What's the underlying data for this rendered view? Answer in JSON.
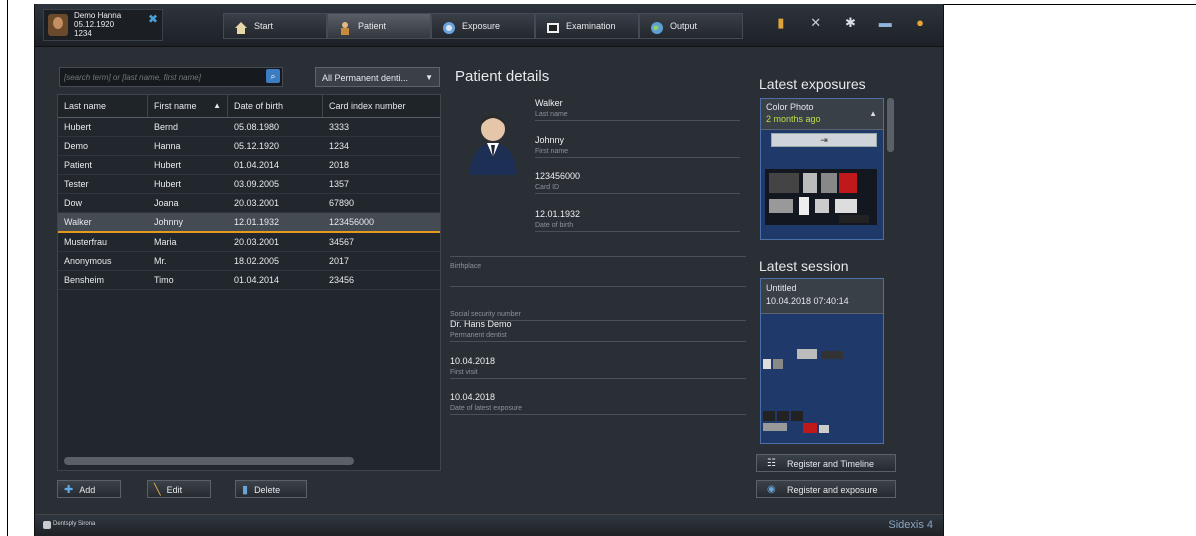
{
  "header": {
    "patient": {
      "name": "Demo Hanna",
      "dob": "05.12.1920",
      "id": "1234"
    },
    "tabs": [
      {
        "label": "Start",
        "icon": "home-icon"
      },
      {
        "label": "Patient",
        "icon": "person-icon"
      },
      {
        "label": "Exposure",
        "icon": "camera-icon"
      },
      {
        "label": "Examination",
        "icon": "monitor-icon"
      },
      {
        "label": "Output",
        "icon": "globe-icon"
      }
    ],
    "active_tab": "Patient",
    "tool_icons": [
      "bookmark-icon",
      "tools-icon",
      "gear-icon",
      "window-icon",
      "info-icon"
    ]
  },
  "patients": {
    "search_placeholder": "[search term] or [last name, first name]",
    "filter": "All Permanent denti...",
    "columns": [
      "Last name",
      "First name",
      "Date of birth",
      "Card index number"
    ],
    "rows": [
      [
        "Hubert",
        "Bernd",
        "05.08.1980",
        "3333"
      ],
      [
        "Demo",
        "Hanna",
        "05.12.1920",
        "1234"
      ],
      [
        "Patient",
        "Hubert",
        "01.04.2014",
        "2018"
      ],
      [
        "Tester",
        "Hubert",
        "03.09.2005",
        "1357"
      ],
      [
        "Dow",
        "Joana",
        "20.03.2001",
        "67890"
      ],
      [
        "Walker",
        "Johnny",
        "12.01.1932",
        "123456000"
      ],
      [
        "Musterfrau",
        "Maria",
        "20.03.2001",
        "34567"
      ],
      [
        "Anonymous",
        "Mr.",
        "18.02.2005",
        "2017"
      ],
      [
        "Bensheim",
        "Timo",
        "01.04.2014",
        "23456"
      ]
    ],
    "selected_row": 5,
    "buttons": {
      "add": "Add",
      "edit": "Edit",
      "delete": "Delete"
    }
  },
  "details": {
    "title": "Patient details",
    "last_name": {
      "value": "Walker",
      "label": "Last name"
    },
    "first_name": {
      "value": "Johnny",
      "label": "First name"
    },
    "card_id": {
      "value": "123456000",
      "label": "Card ID"
    },
    "dob": {
      "value": "12.01.1932",
      "label": "Date of birth"
    },
    "birthplace": {
      "value": "",
      "label": "Birthplace"
    },
    "ssn": {
      "value": "",
      "label": "Social security number"
    },
    "dentist": {
      "value": "Dr. Hans Demo",
      "label": "Permanent dentist"
    },
    "first_visit": {
      "value": "10.04.2018",
      "label": "First visit"
    },
    "latest_exposure": {
      "value": "10.04.2018",
      "label": "Date of latest exposure"
    }
  },
  "right": {
    "latest_exposures_title": "Latest exposures",
    "exposure_card": {
      "title": "Color Photo",
      "subtitle": "2 months ago"
    },
    "latest_session_title": "Latest session",
    "session_card": {
      "title": "Untitled",
      "subtitle": "10.04.2018 07:40:14"
    },
    "buttons": {
      "register_timeline": "Register and Timeline",
      "register_exposure": "Register and exposure"
    }
  },
  "footer": {
    "brand": "Dentsply Sirona",
    "product": "Sidexis 4"
  }
}
